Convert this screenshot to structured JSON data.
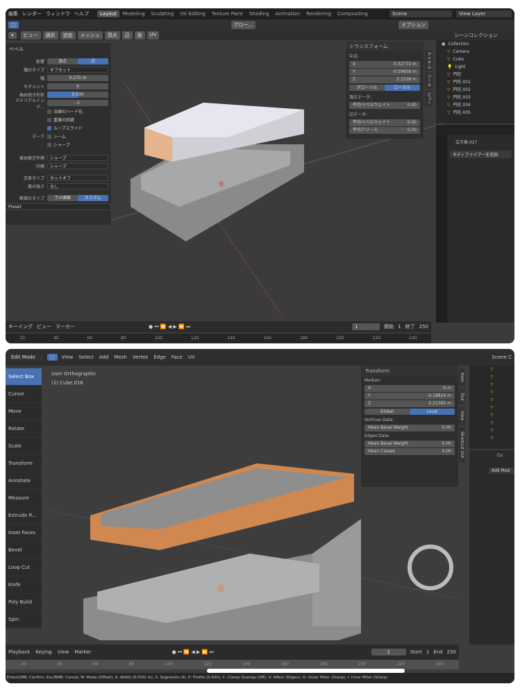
{
  "top": {
    "menu": [
      "編集",
      "レンダー",
      "ウィンドウ",
      "ヘルプ"
    ],
    "workspaces": [
      "Layout",
      "Modeling",
      "Sculpting",
      "UV Editing",
      "Texture Paint",
      "Shading",
      "Animation",
      "Rendering",
      "Compositing"
    ],
    "active_workspace": "Layout",
    "scene": "Scene",
    "view_layer": "View Layer",
    "orientation": "グロー...",
    "options": "オプション",
    "viewport_menu": [
      "ビュー",
      "選択",
      "追加",
      "メッシュ",
      "頂点",
      "辺",
      "面",
      "UV"
    ],
    "bevel": {
      "title": "ベベル",
      "affect_label": "影響",
      "affect_options": [
        "頂点",
        "辺"
      ],
      "affect_selected": "辺",
      "width_type_label": "幅のタイプ",
      "width_type": "オフセット",
      "width_label": "幅",
      "width": "0.275 m",
      "segments_label": "セグメント",
      "segments": "4",
      "shape_label": "曲め続き形状",
      "shape": "0.500",
      "shape_fraction": 0.5,
      "material_label": "マテリアルインデ...",
      "material": "-1",
      "checks": [
        {
          "label": "法線のハード化",
          "on": false
        },
        {
          "label": "重複の回避",
          "on": false
        },
        {
          "label": "ループスライド",
          "on": true
        }
      ],
      "mark_label": "マーク",
      "marks": [
        {
          "label": "シーム",
          "on": false
        },
        {
          "label": "シャープ",
          "on": false
        }
      ],
      "outer_label": "留め継ぎ外側",
      "outer": "シャープ",
      "inner_label": "内側",
      "inner": "シャープ",
      "intersect_label": "交差タイプ",
      "intersect": "カットオフ",
      "face_label": "面の強さ",
      "face": "なし",
      "profile_label": "断面のタイプ",
      "profile_options": [
        "ラメ曲線",
        "カスタム"
      ],
      "profile_selected": "カスタム",
      "preset": "Preset"
    },
    "transform": {
      "title": "トランスフォーム",
      "median": "中点:",
      "x": "-0.52772 m",
      "y": "-0.59608 m",
      "z": "5.1538 m",
      "global": "グローバル",
      "local": "ローカル",
      "vertices_data": "頂点データ:",
      "mean_bevel_weight": "平均ベベルウェイト",
      "vbw": "0.00",
      "edges_data": "辺データ:",
      "ebw": "0.00",
      "mean_crease": "平均クリース",
      "crease": "0.00"
    },
    "side_tabs": [
      "アイテム",
      "ツール",
      "ビュー"
    ],
    "outliner": {
      "scene_collection": "シーンコレクション",
      "collection": "Collection",
      "items": [
        "Camera",
        "Cube",
        "Light",
        "円柱",
        "円柱.001",
        "円柱.002",
        "円柱.003",
        "円柱.004",
        "円柱.005"
      ]
    },
    "properties": {
      "object": "立方体.017",
      "add_modifier": "モディファイアーを追加"
    },
    "timeline": {
      "menu": [
        "キーイング",
        "ビュー",
        "マーカー"
      ],
      "frame": "1",
      "start_label": "開始",
      "start": "1",
      "end_label": "終了",
      "end": "250",
      "ticks": [
        "20",
        "40",
        "60",
        "80",
        "100",
        "120",
        "140",
        "160",
        "180",
        "200",
        "220",
        "240"
      ]
    }
  },
  "bottom": {
    "mode": "Edit Mode",
    "viewport_menu": [
      "View",
      "Select",
      "Add",
      "Mesh",
      "Vertex",
      "Edge",
      "Face",
      "UV"
    ],
    "view_name": "User Orthographic",
    "object_name": "(1) Cube.016",
    "tools": [
      "Select Box",
      "Cursor",
      "Move",
      "Rotate",
      "Scale",
      "Transform",
      "Annotate",
      "Measure",
      "Extrude R...",
      "Inset Faces",
      "Bevel",
      "Loop Cut",
      "Knife",
      "Poly Build",
      "Spin"
    ],
    "active_tool": "Select Box",
    "transform": {
      "title": "Transform",
      "median": "Median:",
      "x": "0 m",
      "y": "-0.18824 m",
      "z": "0.21365 m",
      "global": "Global",
      "local": "Local",
      "vertices_data": "Vertices Data:",
      "mean_bevel_weight": "Mean Bevel Weight",
      "vbw": "0.00",
      "edges_data": "Edges Data:",
      "ebw": "0.00",
      "mean_crease": "Mean Crease",
      "crease": "0.00"
    },
    "side_tabs": [
      "Item",
      "Tool",
      "View",
      "Shortcut VUr"
    ],
    "outliner": {
      "scene_collection": "Scene C"
    },
    "properties": {
      "object": "Cu",
      "add_modifier": "Add Mod"
    },
    "timeline": {
      "menu": [
        "Playback",
        "Keying",
        "View",
        "Marker"
      ],
      "frame": "1",
      "start_label": "Start",
      "start": "1",
      "end_label": "End",
      "end": "250",
      "ticks": [
        "20",
        "40",
        "60",
        "80",
        "100",
        "120",
        "140",
        "160",
        "180",
        "200",
        "220",
        "240"
      ]
    },
    "status": "Enter/LMB: Confirm, Esc/RMB: Cancel, M: Mode (Offset), A: Width (0.033) m), S: Segments (4), P: Profile (0.500), C: Clamp Overlap (Off), V: Affect (Edges), O: Outer Miter (Sharp), I: Inner Miter (Sharp)"
  },
  "colors": {
    "accent": "#4772b3",
    "bevel_orange": "#e8a070",
    "bg": "#3b3b3b"
  }
}
